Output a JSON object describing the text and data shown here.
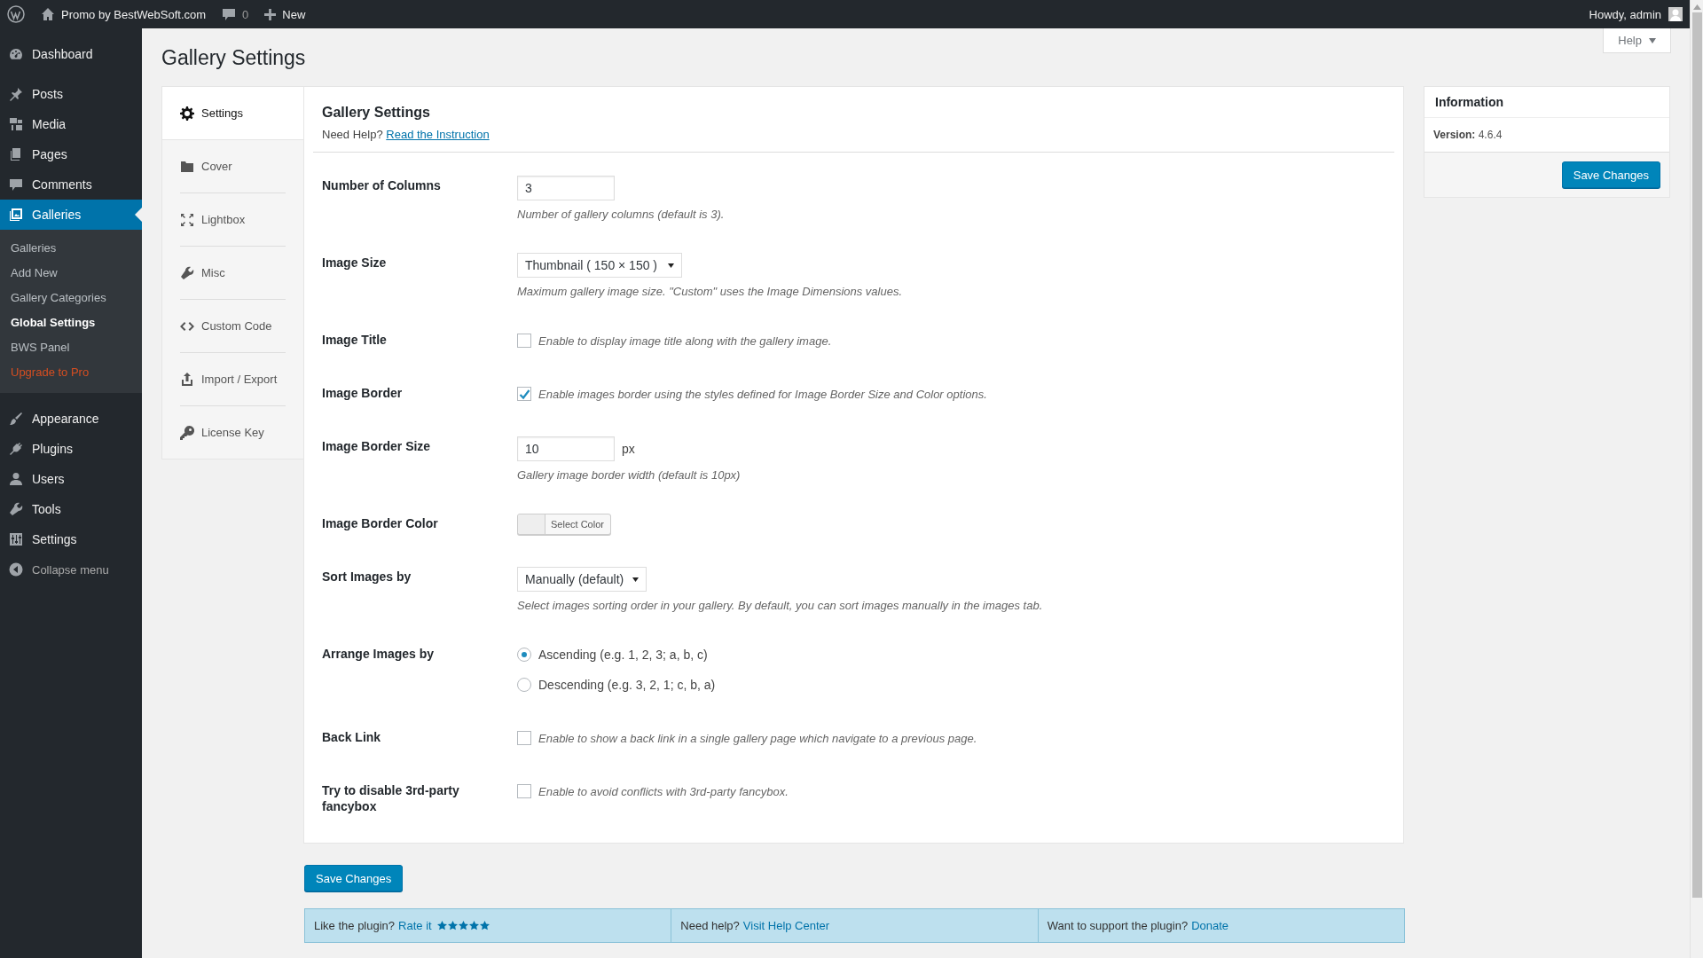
{
  "admin_bar": {
    "site_title": "Promo by BestWebSoft.com",
    "comment_count": "0",
    "new_label": "New",
    "greeting": "Howdy, admin"
  },
  "help_button": "Help",
  "page_title": "Gallery Settings",
  "admin_menu": [
    {
      "label": "Dashboard",
      "selected": false
    },
    {
      "label": "Posts",
      "selected": false
    },
    {
      "label": "Media",
      "selected": false
    },
    {
      "label": "Pages",
      "selected": false
    },
    {
      "label": "Comments",
      "selected": false
    },
    {
      "label": "Galleries",
      "selected": true,
      "children": [
        {
          "label": "Galleries",
          "selected": false,
          "kind": "link"
        },
        {
          "label": "Add New",
          "selected": false,
          "kind": "link"
        },
        {
          "label": "Gallery Categories",
          "selected": false,
          "kind": "link"
        },
        {
          "label": "Global Settings",
          "selected": true,
          "kind": "link"
        },
        {
          "label": "BWS Panel",
          "selected": false,
          "kind": "link"
        },
        {
          "label": "Upgrade to Pro",
          "selected": false,
          "kind": "upgrade"
        }
      ]
    },
    {
      "label": "Appearance",
      "selected": false
    },
    {
      "label": "Plugins",
      "selected": false
    },
    {
      "label": "Users",
      "selected": false
    },
    {
      "label": "Tools",
      "selected": false
    },
    {
      "label": "Settings",
      "selected": false
    }
  ],
  "collapse_menu": "Collapse menu",
  "tabs": [
    {
      "label": "Settings",
      "selected": true
    },
    {
      "label": "Cover",
      "selected": false
    },
    {
      "label": "Lightbox",
      "selected": false
    },
    {
      "label": "Misc",
      "selected": false
    },
    {
      "label": "Custom Code",
      "selected": false
    },
    {
      "label": "Import / Export",
      "selected": false
    },
    {
      "label": "License Key",
      "selected": false
    }
  ],
  "panel": {
    "title": "Gallery Settings",
    "help_prefix": "Need Help?",
    "help_link": "Read the Instruction",
    "rows": [
      {
        "kind": "number",
        "label": "Number of Columns",
        "value": "3",
        "description": "Number of gallery columns (default is 3)."
      },
      {
        "kind": "select",
        "label": "Image Size",
        "value": "Thumbnail ( 150 × 150 )",
        "description": "Maximum gallery image size. \"Custom\" uses the Image Dimensions values."
      },
      {
        "kind": "checkbox",
        "label": "Image Title",
        "checked": false,
        "text": "Enable to display image title along with the gallery image."
      },
      {
        "kind": "checkbox",
        "label": "Image Border",
        "checked": true,
        "text": "Enable images border using the styles defined for Image Border Size and Color options."
      },
      {
        "kind": "number",
        "label": "Image Border Size",
        "value": "10",
        "unit": "px",
        "description": "Gallery image border width (default is 10px)"
      },
      {
        "kind": "color",
        "label": "Image Border Color",
        "button": "Select Color"
      },
      {
        "kind": "select",
        "label": "Sort Images by",
        "value": "Manually (default)",
        "description": "Select images sorting order in your gallery. By default, you can sort images manually in the images tab."
      },
      {
        "kind": "radio",
        "label": "Arrange Images by",
        "options": [
          {
            "label": "Ascending (e.g. 1, 2, 3; a, b, c)",
            "selected": true
          },
          {
            "label": "Descending (e.g. 3, 2, 1; c, b, a)",
            "selected": false
          }
        ]
      },
      {
        "kind": "checkbox",
        "label": "Back Link",
        "checked": false,
        "text": "Enable to show a back link in a single gallery page which navigate to a previous page."
      },
      {
        "kind": "checkbox",
        "label": "Try to disable 3rd-party fancybox",
        "checked": false,
        "text": "Enable to avoid conflicts with 3rd-party fancybox."
      }
    ]
  },
  "save_button": "Save Changes",
  "info_box": {
    "title": "Information",
    "version_label": "Version:",
    "version": "4.6.4",
    "save_button": "Save Changes"
  },
  "footer": [
    {
      "prefix": "Like the plugin?",
      "link": "Rate it",
      "stars": 5
    },
    {
      "prefix": "Need help?",
      "link": "Visit Help Center"
    },
    {
      "prefix": "Want to support the plugin?",
      "link": "Donate"
    }
  ]
}
